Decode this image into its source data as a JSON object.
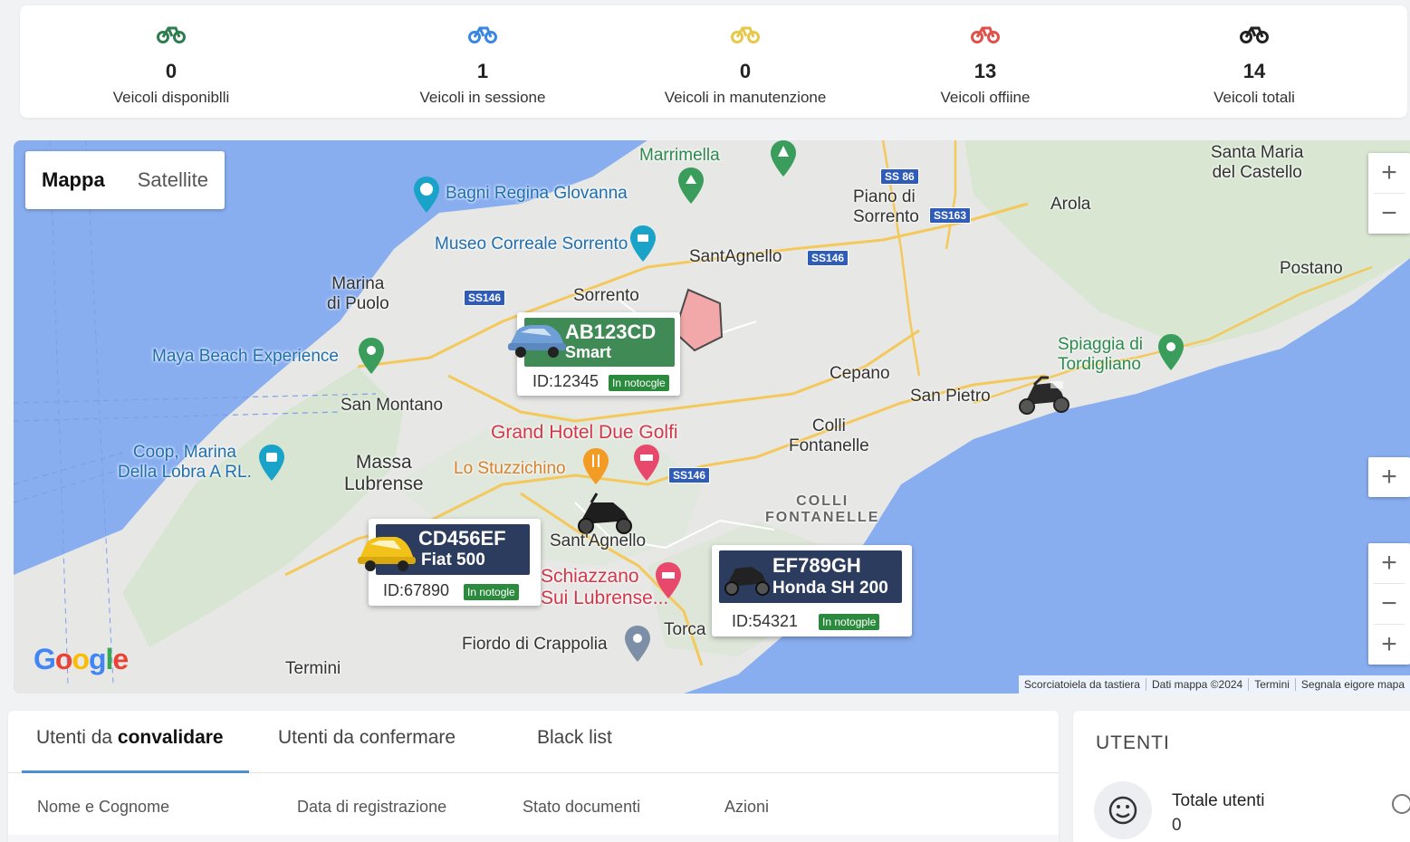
{
  "stats": [
    {
      "value": "0",
      "label": "Veicoli disponiblli",
      "color": "#2e7d4f",
      "icon": "bike-icon"
    },
    {
      "value": "1",
      "label": "Veicoli in sessione",
      "color": "#3a86e0",
      "icon": "bike-icon"
    },
    {
      "value": "0",
      "label": "Veicoli in manutenzione",
      "color": "#e8c84a",
      "icon": "bike-icon"
    },
    {
      "value": "13",
      "label": "Veicoli offiine",
      "color": "#e2504a",
      "icon": "bike-icon"
    },
    {
      "value": "14",
      "label": "Veicoli totali",
      "color": "#222222",
      "icon": "bike-icon"
    }
  ],
  "map": {
    "toggle": {
      "map": "Mappa",
      "satellite": "Satellite"
    },
    "zoom": {
      "plus": "+",
      "minus": "−"
    },
    "labels": {
      "marrimella": "Marrimella",
      "bagni": "Bagni Regina Glovanna",
      "museo": "Museo Correale Sorrento",
      "piano": "Piano di\nSorrento",
      "arola": "Arola",
      "santa_maria": "Santa Maria\ndel Castello",
      "postano": "Postano",
      "santagnello_top": "SantAgnello",
      "marina": "Marina\ndi Puolo",
      "sorrento": "Sorrento",
      "maya": "Maya Beach Experience",
      "cepano": "Cepano",
      "san_pietro": "San Pietro",
      "spiaggia": "Spiaggia di\nTordigliano",
      "san_montano": "San Montano",
      "grand_hotel": "Grand Hotel Due Golfi",
      "colli": "Colli\nFontanelle",
      "coop": "Coop, Marina\nDella Lobra A RL.",
      "massa": "Massa\nLubrense",
      "stuzzichino": "Lo Stuzzichino",
      "colli_caps": "COLLI\nFONTANELLE",
      "santagnello_mid": "Sant'Agnello",
      "schiazzano": "Schiazzano\nSui Lubrense...",
      "torca": "Torca",
      "fiordo": "Fiordo di Crappolia",
      "termini": "Termini"
    },
    "shields": {
      "ss86": "SS 86",
      "ss163": "SS163",
      "ss146a": "SS146",
      "ss146b": "SS146",
      "ss146c": "SS146"
    },
    "vehicles": [
      {
        "plate": "AB123CD",
        "model": "Smart",
        "id_label": "ID:12345",
        "status": "In notocgle",
        "head_color": "#3f8a55",
        "car_color": "#6f9fd6"
      },
      {
        "plate": "CD456EF",
        "model": "Fiat 500",
        "id_label": "ID:67890",
        "status": "In notogle",
        "head_color": "#2c3c5e",
        "car_color": "#f2c21b"
      },
      {
        "plate": "EF789GH",
        "model": "Honda SH 200",
        "id_label": "ID:54321",
        "status": "In notogple",
        "head_color": "#2c3c5e",
        "car_color": "#222222"
      }
    ],
    "google": "Google",
    "attribution": [
      "Scorciatoiela da tastiera",
      "Dati mappa ©2024",
      "Termini",
      "Segnala eigore mapa"
    ]
  },
  "users": {
    "tabs": [
      {
        "pre": "Utenti da ",
        "bold": "convalidare"
      },
      {
        "pre": "Utenti da confermare",
        "bold": ""
      },
      {
        "pre": "Black list",
        "bold": ""
      }
    ],
    "columns": [
      "Nome e Cognome",
      "Data di registrazione",
      "Stato documenti",
      "Azioni"
    ]
  },
  "summary": {
    "title": "UTENTI",
    "total_label": "Totale utenti",
    "total_value": "0"
  }
}
